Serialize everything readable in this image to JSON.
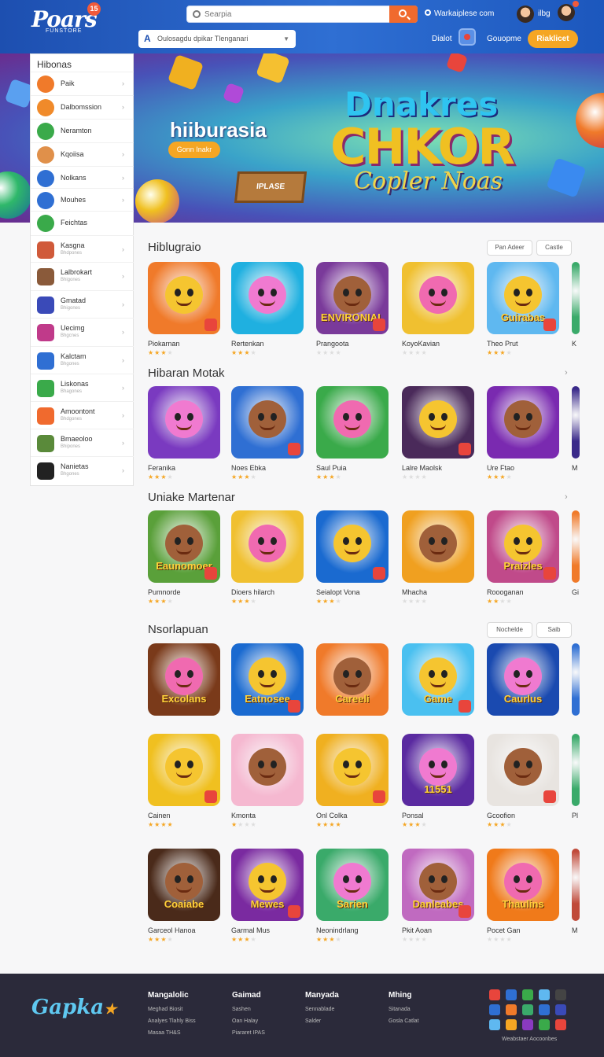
{
  "header": {
    "logo": "Poars",
    "logo_sub": "FUNSTORE",
    "logo_badge": "15",
    "search_placeholder": "Searpia",
    "link_site": "Warkaiplese com",
    "user_name": "ilbg",
    "category_select": "Oulosagdu dpikar Tlenganari",
    "link_deals": "Dialot",
    "link_compare": "Gouopme",
    "cta": "Riaklicet"
  },
  "hero": {
    "heading": "hiiburasia",
    "button": "Gonn Inakr",
    "title_line1": "Dnakres",
    "title_line2": "CHKOR",
    "title_line3": "Copler Noas",
    "crate_text": "IPLASE"
  },
  "sidebar": {
    "title": "Hibonas",
    "items": [
      {
        "label": "Paik",
        "sub": ""
      },
      {
        "label": "Dalbomssion",
        "sub": ""
      },
      {
        "label": "Neramton",
        "sub": ""
      },
      {
        "label": "Kqoiisa",
        "sub": ""
      },
      {
        "label": "Nolkans",
        "sub": ""
      },
      {
        "label": "Mouhes",
        "sub": ""
      },
      {
        "label": "Feichtas",
        "sub": ""
      },
      {
        "label": "Kasgna",
        "sub": "Bhdpones"
      },
      {
        "label": "Lalbrokart",
        "sub": "Bhigones"
      },
      {
        "label": "Gmatad",
        "sub": "Bhigones"
      },
      {
        "label": "Uecimg",
        "sub": "Bhgcnes"
      },
      {
        "label": "Kalctam",
        "sub": "Bhgones"
      },
      {
        "label": "Liskonas",
        "sub": "Bhagones"
      },
      {
        "label": "Amoontont",
        "sub": "Bhdgones"
      },
      {
        "label": "Bmaeoloo",
        "sub": "Bhipones"
      },
      {
        "label": "Nanietas",
        "sub": "Bhgones"
      }
    ]
  },
  "sections": [
    {
      "title": "Hiblugraio",
      "buttons": [
        "Pan Adeer",
        "Castle"
      ],
      "tiles": [
        {
          "name": "Piokarnan",
          "rating": 3,
          "word": ""
        },
        {
          "name": "Rertenkan",
          "rating": 3,
          "word": ""
        },
        {
          "name": "Prangoota",
          "rating": 0,
          "word": "ENVIRONIAL"
        },
        {
          "name": "KoyoKavian",
          "rating": 0,
          "word": ""
        },
        {
          "name": "Theo Prut",
          "rating": 3,
          "word": "Guirabas"
        },
        {
          "name": "K",
          "rating": 0,
          "word": ""
        }
      ]
    },
    {
      "title": "Hibaran Motak",
      "buttons": [],
      "tiles": [
        {
          "name": "Feranika",
          "rating": 3,
          "word": ""
        },
        {
          "name": "Noes Ebka",
          "rating": 3,
          "word": ""
        },
        {
          "name": "Saul Puia",
          "rating": 3,
          "word": ""
        },
        {
          "name": "Lalre Maolsk",
          "rating": 0,
          "word": ""
        },
        {
          "name": "Ure Ftao",
          "rating": 3,
          "word": ""
        },
        {
          "name": "M",
          "rating": 0,
          "word": ""
        }
      ]
    },
    {
      "title": "Uniake Martenar",
      "buttons": [],
      "tiles": [
        {
          "name": "Pumnorde",
          "rating": 3,
          "word": "Eaunomoer"
        },
        {
          "name": "Dioers hilarch",
          "rating": 3,
          "word": ""
        },
        {
          "name": "Seialopt Vona",
          "rating": 3,
          "word": ""
        },
        {
          "name": "Mhacha",
          "rating": 0,
          "word": ""
        },
        {
          "name": "Roooganan",
          "rating": 2,
          "word": "Praizles"
        },
        {
          "name": "Gi",
          "rating": 0,
          "word": ""
        }
      ]
    },
    {
      "title": "Nsorlapuan",
      "buttons": [
        "Nochelde",
        "Saib"
      ],
      "tiles": [
        {
          "name": "",
          "rating": -1,
          "word": "Excolans"
        },
        {
          "name": "",
          "rating": -1,
          "word": "Eatnosee"
        },
        {
          "name": "",
          "rating": -1,
          "word": "Careeli"
        },
        {
          "name": "",
          "rating": -1,
          "word": "Game"
        },
        {
          "name": "",
          "rating": -1,
          "word": "Caurlus"
        },
        {
          "name": "",
          "rating": -1,
          "word": ""
        }
      ]
    },
    {
      "title": "",
      "buttons": [],
      "tiles": [
        {
          "name": "Cainen",
          "rating": 4,
          "word": ""
        },
        {
          "name": "Kmonta",
          "rating": 1,
          "word": ""
        },
        {
          "name": "Onl Colka",
          "rating": 4,
          "word": ""
        },
        {
          "name": "Ponsal",
          "rating": 3,
          "word": "11551"
        },
        {
          "name": "Gcoofion",
          "rating": 3,
          "word": ""
        },
        {
          "name": "Pl",
          "rating": 0,
          "word": ""
        }
      ]
    },
    {
      "title": "",
      "buttons": [],
      "tiles": [
        {
          "name": "Garceol Hanoa",
          "rating": 3,
          "word": "Coaiabe"
        },
        {
          "name": "Garmal Mus",
          "rating": 3,
          "word": "Mewes"
        },
        {
          "name": "Neonindrlang",
          "rating": 3,
          "word": "Sarien"
        },
        {
          "name": "Pkit Aoan",
          "rating": 0,
          "word": "Danleabes"
        },
        {
          "name": "Pocet Gan",
          "rating": 0,
          "word": "Thaulins"
        },
        {
          "name": "M",
          "rating": 0,
          "word": ""
        }
      ]
    }
  ],
  "footer": {
    "logo": "Gapka",
    "cols": [
      {
        "head": "Mangalolic",
        "links": [
          "Meghad Biosit",
          "Analyes Tlahly Biss",
          "Masaa TH&S"
        ]
      },
      {
        "head": "Gaimad",
        "links": [
          "Sashen",
          "Oan Halay",
          "Piararet IPAS"
        ]
      },
      {
        "head": "Manyada",
        "links": [
          "Sennablade",
          "Salder"
        ]
      },
      {
        "head": "Mhing",
        "links": [
          "Sitanada",
          "Gosla Catlat"
        ]
      }
    ],
    "credit": "Weabstaer Aocoonbes"
  },
  "colors": {
    "brand": "#1d4fb0",
    "accent": "#f5a623",
    "search_button": "#f06a2e",
    "footer_bg": "#2b2a3a"
  }
}
